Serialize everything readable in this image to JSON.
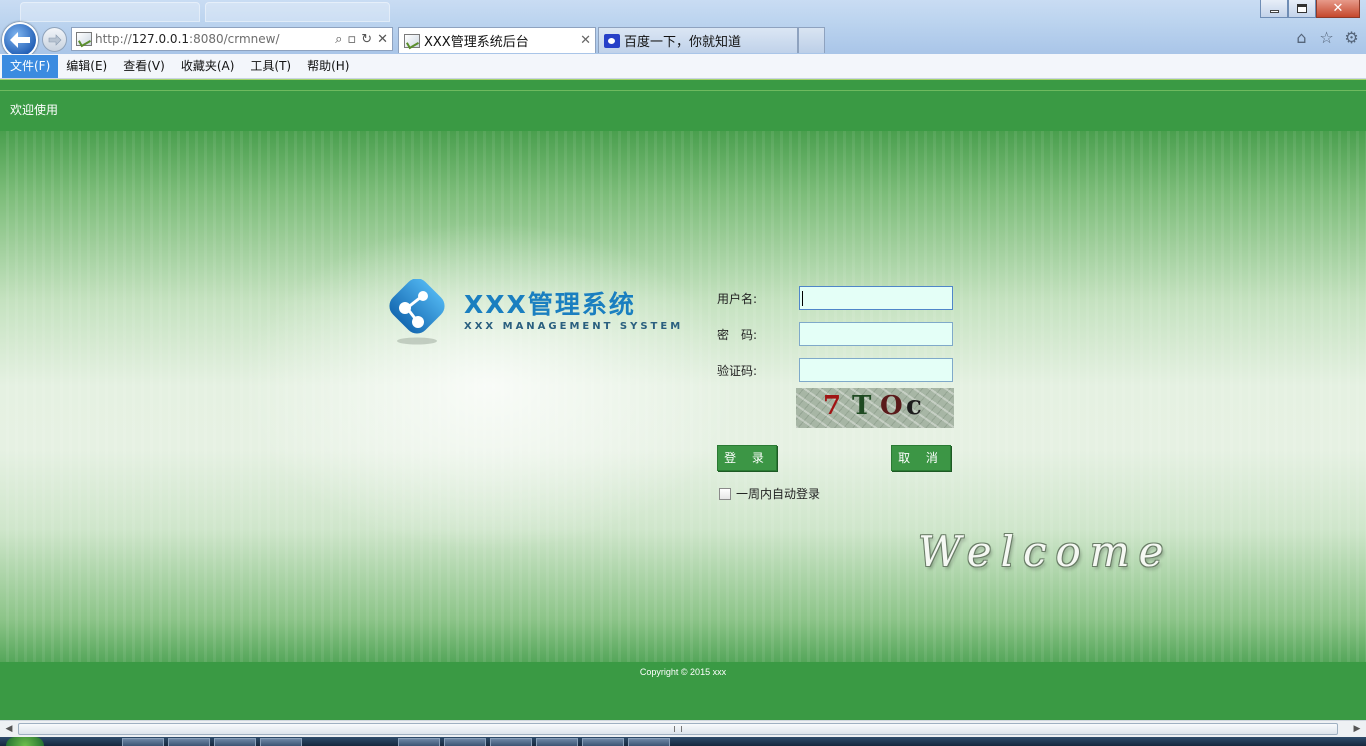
{
  "browser": {
    "url_scheme": "http://",
    "url_host": "127.0.0.1",
    "url_rest": ":8080/crmnew/",
    "tabs": [
      {
        "label": "XXX管理系统后台",
        "active": true
      },
      {
        "label": "百度一下，你就知道",
        "active": false
      }
    ],
    "menu": [
      "文件(F)",
      "编辑(E)",
      "查看(V)",
      "收藏夹(A)",
      "工具(T)",
      "帮助(H)"
    ],
    "icons": {
      "back": "back-arrow-icon",
      "forward": "forward-arrow-icon",
      "home": "home-icon",
      "favorites": "star-icon",
      "tools": "gear-icon"
    }
  },
  "page": {
    "welcome": "欢迎使用",
    "logo": {
      "title": "XXX管理系统",
      "subtitle": "XXX MANAGEMENT SYSTEM"
    },
    "form": {
      "username_label": "用户名:",
      "password_label": "密　码:",
      "captcha_label": "验证码:",
      "username_value": "",
      "password_value": "",
      "captcha_value": "",
      "captcha_chars": [
        "7",
        "T",
        "O",
        "c"
      ],
      "login_button": "登 录",
      "cancel_button": "取 消",
      "remember_label": "一周内自动登录",
      "remember_checked": false
    },
    "welcome_script": "Welcome",
    "copyright": "Copyright © 2015 xxx"
  },
  "colors": {
    "brand_green": "#3a9a44",
    "logo_blue": "#1a7fc0",
    "input_bg": "#e4fff7"
  }
}
